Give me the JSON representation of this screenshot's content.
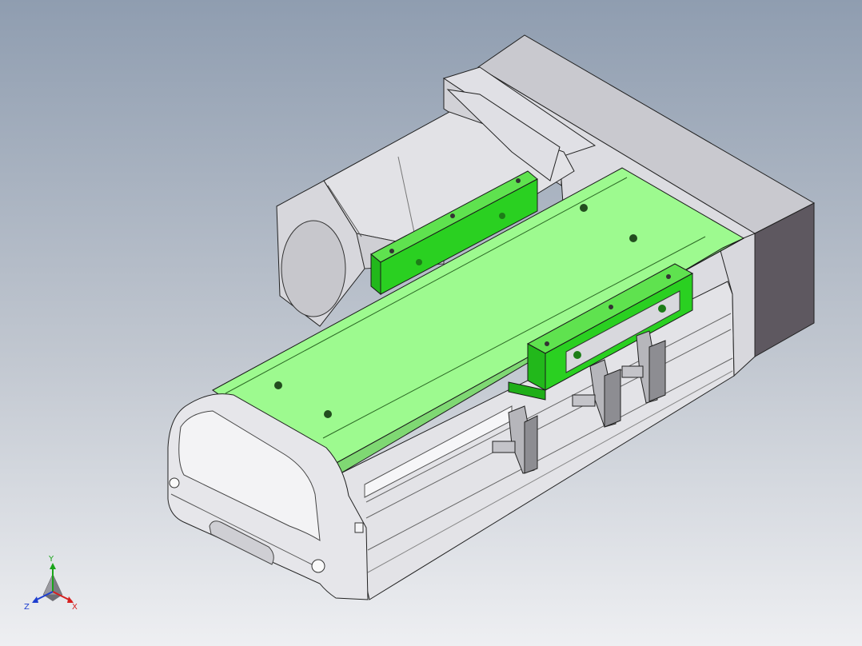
{
  "viewport": {
    "background_top": "#8f9db0",
    "background_bottom": "#eeeff2"
  },
  "model": {
    "highlight_color": "#9dfa8f",
    "block_color": "#2ad021",
    "body_color": "#e6e6ea",
    "motor_color": "#d8d8dc"
  },
  "triad": {
    "x_label": "X",
    "y_label": "Y",
    "z_label": "Z",
    "x_color": "#d61f1f",
    "y_color": "#1aa51a",
    "z_color": "#1e3fcf"
  }
}
